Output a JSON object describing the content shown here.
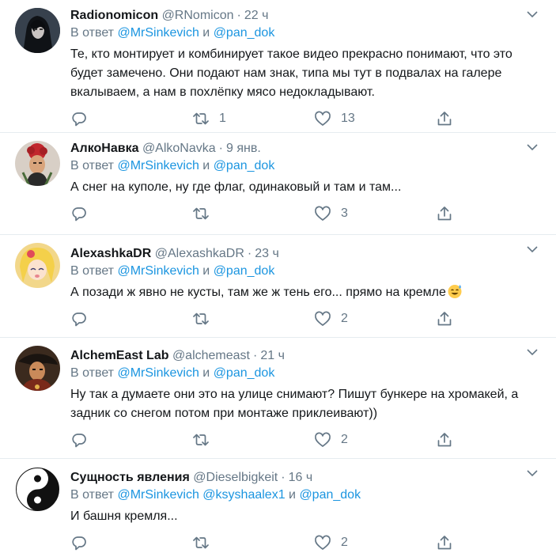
{
  "reply_prefix": "В ответ",
  "connector": "и",
  "tweets": [
    {
      "name": "Radionomicon",
      "handle": "@RNomicon",
      "time": "22 ч",
      "mentions": [
        "@MrSinkevich",
        "@pan_dok"
      ],
      "text": "Те, кто монтирует и комбинирует такое видео прекрасно понимают, что это будет замечено. Они подают нам знак, типа мы тут в подвалах на галере вкалываем, а нам в похлёпку мясо недокладывают.",
      "replies": "",
      "retweets": "1",
      "likes": "13"
    },
    {
      "name": "АлкоНавка",
      "handle": "@AlkoNavka",
      "time": "9 янв.",
      "mentions": [
        "@MrSinkevich",
        "@pan_dok"
      ],
      "text": "А снег на куполе, ну где флаг, одинаковый и там и там...",
      "replies": "",
      "retweets": "",
      "likes": "3"
    },
    {
      "name": "AlexashkaDR",
      "handle": "@AlexashkaDR",
      "time": "23 ч",
      "mentions": [
        "@MrSinkevich",
        "@pan_dok"
      ],
      "text": "А позади ж явно не кусты, там же ж тень его... прямо на кремле",
      "emoji": "sweat-smile-emoji",
      "replies": "",
      "retweets": "",
      "likes": "2"
    },
    {
      "name": "AlchemEast Lab",
      "handle": "@alchemeast",
      "time": "21 ч",
      "mentions": [
        "@MrSinkevich",
        "@pan_dok"
      ],
      "text": "Ну так а думаете они это на улице снимают? Пишут бункере на хромакей, а задник со снегом потом при монтаже приклеивают))",
      "replies": "",
      "retweets": "",
      "likes": "2"
    },
    {
      "name": "Сущность явления",
      "handle": "@Dieselbigkeit",
      "time": "16 ч",
      "mentions": [
        "@MrSinkevich",
        "@ksyshaalex1",
        "@pan_dok"
      ],
      "text": "И башня кремля...",
      "replies": "",
      "retweets": "",
      "likes": "2"
    }
  ],
  "colors": {
    "accent": "#1b95e0",
    "secondary_text": "#657786",
    "primary_text": "#14171a",
    "divider": "#e6ecf0"
  },
  "icons": [
    "reply-icon",
    "retweet-icon",
    "like-icon",
    "share-icon",
    "caret-down-icon"
  ]
}
